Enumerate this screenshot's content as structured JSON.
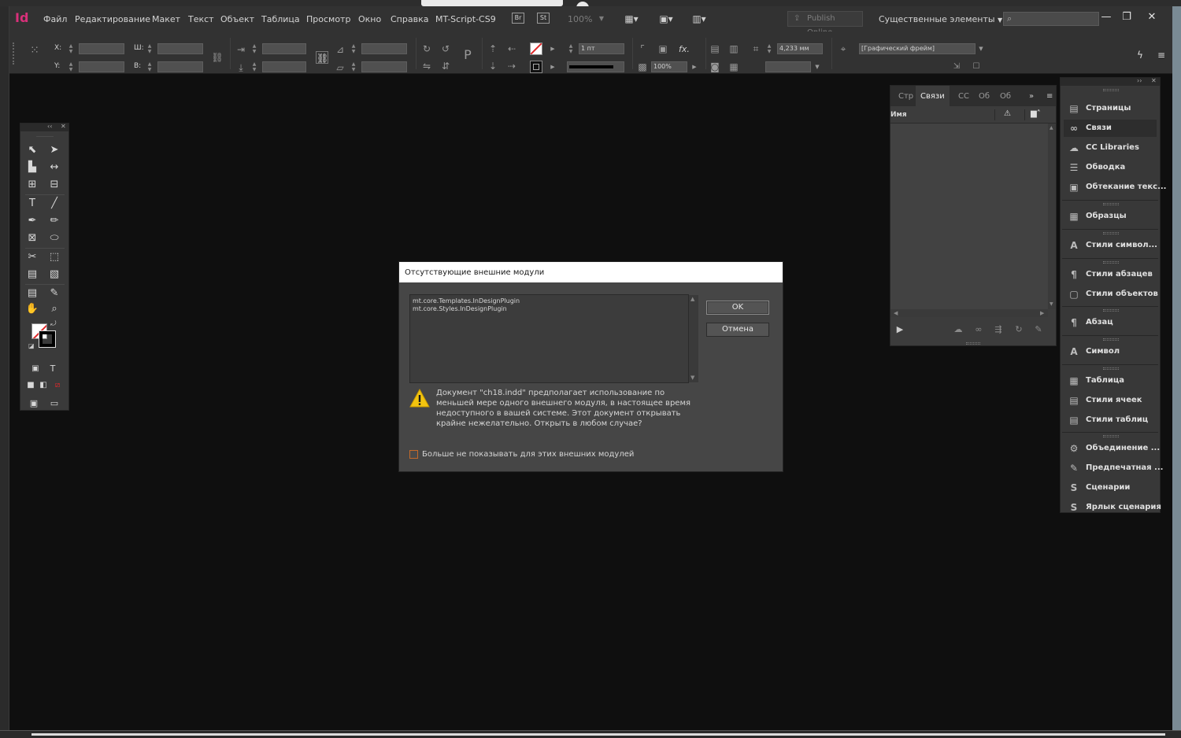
{
  "menubar": {
    "logo": "Id",
    "items": [
      "Файл",
      "Редактирование",
      "Макет",
      "Текст",
      "Объект",
      "Таблица",
      "Просмотр",
      "Окно",
      "Справка",
      "MT-Script-CS9"
    ],
    "bridge_label": "Br",
    "stock_label": "St",
    "zoom": "100%",
    "publish_label": "Publish Online",
    "workspace_label": "Существенные элементы",
    "search_placeholder": "",
    "minimize": "—",
    "maximize": "❐",
    "close": "✕"
  },
  "controlbar": {
    "x_label": "X:",
    "y_label": "Y:",
    "w_label": "Ш:",
    "h_label": "В:",
    "stroke_weight": "1 пт",
    "opacity": "100%",
    "gap_value": "4,233 мм",
    "frame_style": "[Графический фрейм]",
    "fx_label": "fx."
  },
  "tools_panel": {
    "collapse": "‹‹",
    "close": "✕"
  },
  "links_panel": {
    "tabs": [
      "Стр",
      "Связи",
      "СС",
      "Об",
      "Об"
    ],
    "active_tab": "Связи",
    "more": "»",
    "menu": "≡",
    "column_name": "Имя"
  },
  "dock": {
    "collapse": "››",
    "close": "✕",
    "items": [
      {
        "icon": "pages-icon",
        "glyph": "▤",
        "label": "Страницы"
      },
      {
        "icon": "links-icon",
        "glyph": "∞",
        "label": "Связи"
      },
      {
        "icon": "cc-libraries-icon",
        "glyph": "☁",
        "label": "CC Libraries"
      },
      {
        "icon": "stroke-icon",
        "glyph": "☰",
        "label": "Обводка"
      },
      {
        "icon": "text-wrap-icon",
        "glyph": "▣",
        "label": "Обтекание текс..."
      },
      {
        "icon": "swatches-icon",
        "glyph": "▦",
        "label": "Образцы"
      },
      {
        "icon": "char-styles-icon",
        "glyph": "A",
        "label": "Стили символ..."
      },
      {
        "icon": "para-styles-icon",
        "glyph": "¶",
        "label": "Стили абзацев"
      },
      {
        "icon": "object-styles-icon",
        "glyph": "▢",
        "label": "Стили объектов"
      },
      {
        "icon": "paragraph-icon",
        "glyph": "¶",
        "label": "Абзац"
      },
      {
        "icon": "character-icon",
        "glyph": "A",
        "label": "Символ"
      },
      {
        "icon": "table-icon",
        "glyph": "▦",
        "label": "Таблица"
      },
      {
        "icon": "cell-styles-icon",
        "glyph": "▤",
        "label": "Стили ячеек"
      },
      {
        "icon": "table-styles-icon",
        "glyph": "▤",
        "label": "Стили таблиц"
      },
      {
        "icon": "data-merge-icon",
        "glyph": "⚙",
        "label": "Объединение ..."
      },
      {
        "icon": "preflight-icon",
        "glyph": "✎",
        "label": "Предпечатная ..."
      },
      {
        "icon": "scripts-icon",
        "glyph": "S",
        "label": "Сценарии"
      },
      {
        "icon": "script-label-icon",
        "glyph": "S",
        "label": "Ярлык сценария"
      }
    ]
  },
  "dialog": {
    "title": "Отсутствующие внешние модули",
    "modules": [
      "mt.core.Templates.InDesignPlugin",
      "mt.core.Styles.InDesignPlugin"
    ],
    "ok_label": "OK",
    "cancel_label": "Отмена",
    "message": "Документ \"ch18.indd\" предполагает использование по меньшей мере одного внешнего модуля, в настоящее время недоступного в вашей системе. Этот документ открывать крайне нежелательно. Открыть в любом случае?",
    "checkbox_label": "Больше не показывать для этих внешних модулей"
  }
}
